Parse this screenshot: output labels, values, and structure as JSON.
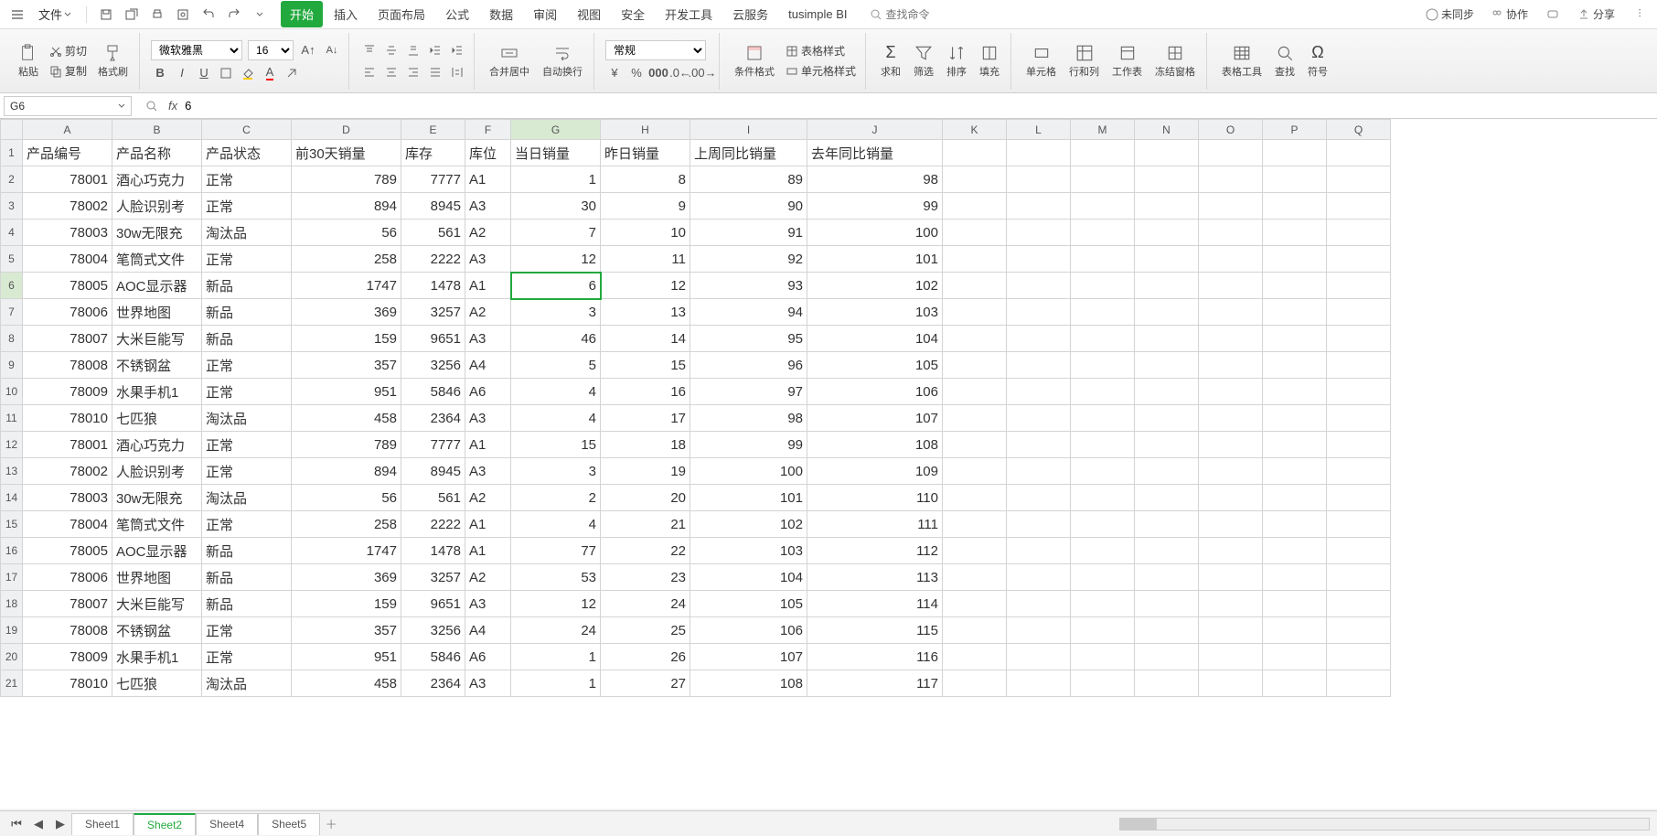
{
  "topbar": {
    "file": "文件",
    "tabs": [
      "开始",
      "插入",
      "页面布局",
      "公式",
      "数据",
      "审阅",
      "视图",
      "安全",
      "开发工具",
      "云服务",
      "tusimple BI"
    ],
    "activeTab": 0,
    "search_placeholder": "查找命令",
    "right": {
      "unsync": "未同步",
      "collab": "协作",
      "share": "分享"
    }
  },
  "ribbon": {
    "paste": "粘贴",
    "cut": "剪切",
    "copy": "复制",
    "format_painter": "格式刷",
    "font_name": "微软雅黑",
    "font_size": "16",
    "merge_center": "合并居中",
    "wrap_text": "自动换行",
    "number_format": "常规",
    "cond_fmt": "条件格式",
    "table_style": "表格样式",
    "cell_style": "单元格样式",
    "sum": "求和",
    "filter": "筛选",
    "sort": "排序",
    "fill": "填充",
    "cells": "单元格",
    "rowcol": "行和列",
    "worksheet": "工作表",
    "freeze": "冻结窗格",
    "table_tool": "表格工具",
    "find": "查找",
    "symbol": "符号"
  },
  "formulaBar": {
    "cellRef": "G6",
    "fx": "fx",
    "value": "6"
  },
  "columns": [
    "A",
    "B",
    "C",
    "D",
    "E",
    "F",
    "G",
    "H",
    "I",
    "J",
    "K",
    "L",
    "M",
    "N",
    "O",
    "P",
    "Q"
  ],
  "headers": [
    "产品编号",
    "产品名称",
    "产品状态",
    "前30天销量",
    "库存",
    "库位",
    "当日销量",
    "昨日销量",
    "上周同比销量",
    "去年同比销量"
  ],
  "rows": [
    [
      78001,
      "酒心巧克力",
      "正常",
      789,
      7777,
      "A1",
      1,
      8,
      89,
      98
    ],
    [
      78002,
      "人脸识别考",
      "正常",
      894,
      8945,
      "A3",
      30,
      9,
      90,
      99
    ],
    [
      78003,
      "30w无限充",
      "淘汰品",
      56,
      561,
      "A2",
      7,
      10,
      91,
      100
    ],
    [
      78004,
      "笔筒式文件",
      "正常",
      258,
      2222,
      "A3",
      12,
      11,
      92,
      101
    ],
    [
      78005,
      "AOC显示器",
      "新品",
      1747,
      1478,
      "A1",
      6,
      12,
      93,
      102
    ],
    [
      78006,
      "世界地图",
      "新品",
      369,
      3257,
      "A2",
      3,
      13,
      94,
      103
    ],
    [
      78007,
      "大米巨能写",
      "新品",
      159,
      9651,
      "A3",
      46,
      14,
      95,
      104
    ],
    [
      78008,
      "不锈钢盆",
      "正常",
      357,
      3256,
      "A4",
      5,
      15,
      96,
      105
    ],
    [
      78009,
      "水果手机1",
      "正常",
      951,
      5846,
      "A6",
      4,
      16,
      97,
      106
    ],
    [
      78010,
      "七匹狼",
      "淘汰品",
      458,
      2364,
      "A3",
      4,
      17,
      98,
      107
    ],
    [
      78001,
      "酒心巧克力",
      "正常",
      789,
      7777,
      "A1",
      15,
      18,
      99,
      108
    ],
    [
      78002,
      "人脸识别考",
      "正常",
      894,
      8945,
      "A3",
      3,
      19,
      100,
      109
    ],
    [
      78003,
      "30w无限充",
      "淘汰品",
      56,
      561,
      "A2",
      2,
      20,
      101,
      110
    ],
    [
      78004,
      "笔筒式文件",
      "正常",
      258,
      2222,
      "A1",
      4,
      21,
      102,
      111
    ],
    [
      78005,
      "AOC显示器",
      "新品",
      1747,
      1478,
      "A1",
      77,
      22,
      103,
      112
    ],
    [
      78006,
      "世界地图",
      "新品",
      369,
      3257,
      "A2",
      53,
      23,
      104,
      113
    ],
    [
      78007,
      "大米巨能写",
      "新品",
      159,
      9651,
      "A3",
      12,
      24,
      105,
      114
    ],
    [
      78008,
      "不锈钢盆",
      "正常",
      357,
      3256,
      "A4",
      24,
      25,
      106,
      115
    ],
    [
      78009,
      "水果手机1",
      "正常",
      951,
      5846,
      "A6",
      1,
      26,
      107,
      116
    ],
    [
      78010,
      "七匹狼",
      "淘汰品",
      458,
      2364,
      "A3",
      1,
      27,
      108,
      117
    ]
  ],
  "selection": {
    "row": 6,
    "col": "G"
  },
  "sheets": {
    "list": [
      "Sheet1",
      "Sheet2",
      "Sheet4",
      "Sheet5"
    ],
    "active": 1
  }
}
